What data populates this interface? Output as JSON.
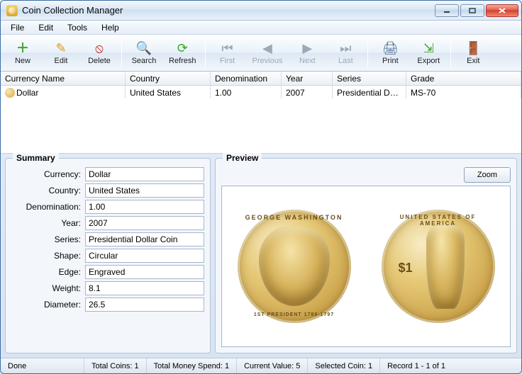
{
  "window": {
    "title": "Coin Collection Manager"
  },
  "menu": {
    "file": "File",
    "edit": "Edit",
    "tools": "Tools",
    "help": "Help"
  },
  "toolbar": {
    "new": "New",
    "edit": "Edit",
    "delete": "Delete",
    "search": "Search",
    "refresh": "Refresh",
    "first": "First",
    "previous": "Previous",
    "next": "Next",
    "last": "Last",
    "print": "Print",
    "export": "Export",
    "exit": "Exit"
  },
  "columns": {
    "name": "Currency Name",
    "country": "Country",
    "denom": "Denomination",
    "year": "Year",
    "series": "Series",
    "grade": "Grade"
  },
  "row": {
    "name": "Dollar",
    "country": "United States",
    "denom": "1.00",
    "year": "2007",
    "series": "Presidential Doll...",
    "grade": "MS-70"
  },
  "summary": {
    "legend": "Summary",
    "labels": {
      "currency": "Currency:",
      "country": "Country:",
      "denom": "Denomination:",
      "year": "Year:",
      "series": "Series:",
      "shape": "Shape:",
      "edge": "Edge:",
      "weight": "Weight:",
      "diameter": "Diameter:"
    },
    "values": {
      "currency": "Dollar",
      "country": "United States",
      "denom": "1.00",
      "year": "2007",
      "series": "Presidential Dollar Coin",
      "shape": "Circular",
      "edge": "Engraved",
      "weight": "8.1",
      "diameter": "26.5"
    }
  },
  "preview": {
    "legend": "Preview",
    "zoom": "Zoom",
    "obverse_top": "GEORGE WASHINGTON",
    "obverse_bot": "1ST PRESIDENT 1789-1797",
    "reverse_top": "UNITED STATES OF AMERICA",
    "reverse_mark": "$1"
  },
  "status": {
    "done": "Done",
    "total_coins": "Total Coins: 1",
    "total_spend": "Total Money Spend: 1",
    "current_value": "Current Value: 5",
    "selected": "Selected Coin: 1",
    "record": "Record 1 - 1 of 1"
  }
}
